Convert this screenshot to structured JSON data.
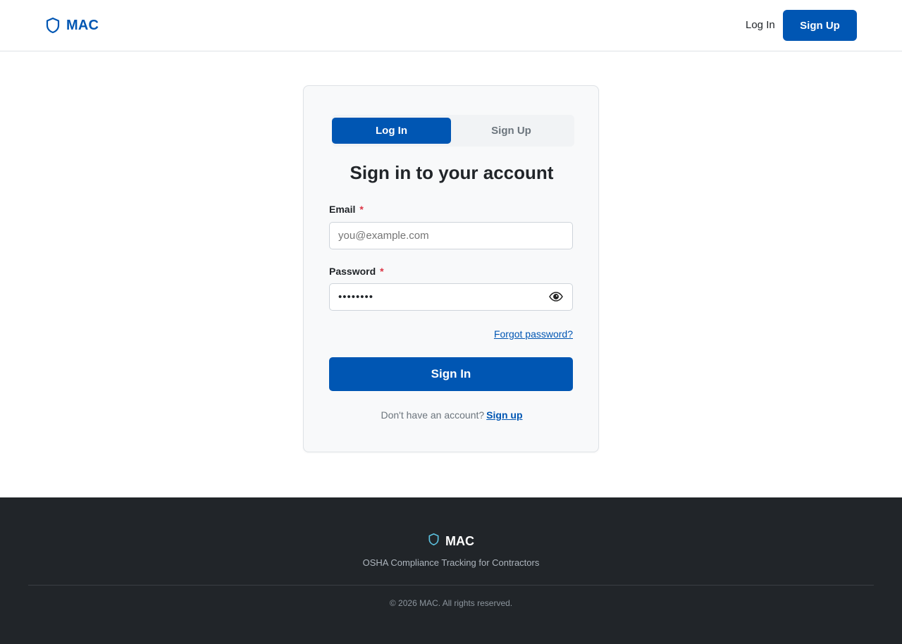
{
  "header": {
    "brand": "MAC",
    "login_label": "Log In",
    "signup_label": "Sign Up"
  },
  "card": {
    "tabs": [
      {
        "label": "Log In",
        "active": true
      },
      {
        "label": "Sign Up",
        "active": false
      }
    ],
    "title": "Sign in to your account",
    "email": {
      "label": "Email",
      "required": "*",
      "placeholder": "you@example.com",
      "value": ""
    },
    "password": {
      "label": "Password",
      "required": "*",
      "value": "••••••••"
    },
    "forgot_label": "Forgot password?",
    "submit_label": "Sign In",
    "switch_text": "Don't have an account?",
    "switch_link": "Sign up"
  },
  "footer": {
    "brand": "MAC",
    "tagline": "OSHA Compliance Tracking for Contractors",
    "copyright": "© 2026 MAC. All rights reserved."
  },
  "colors": {
    "primary": "#0056b3",
    "footer_bg": "#212529",
    "footer_icon": "#5bc0de",
    "required": "#dc3545"
  },
  "icons": {
    "brand": "shield-icon",
    "password_toggle": "eye-icon"
  }
}
